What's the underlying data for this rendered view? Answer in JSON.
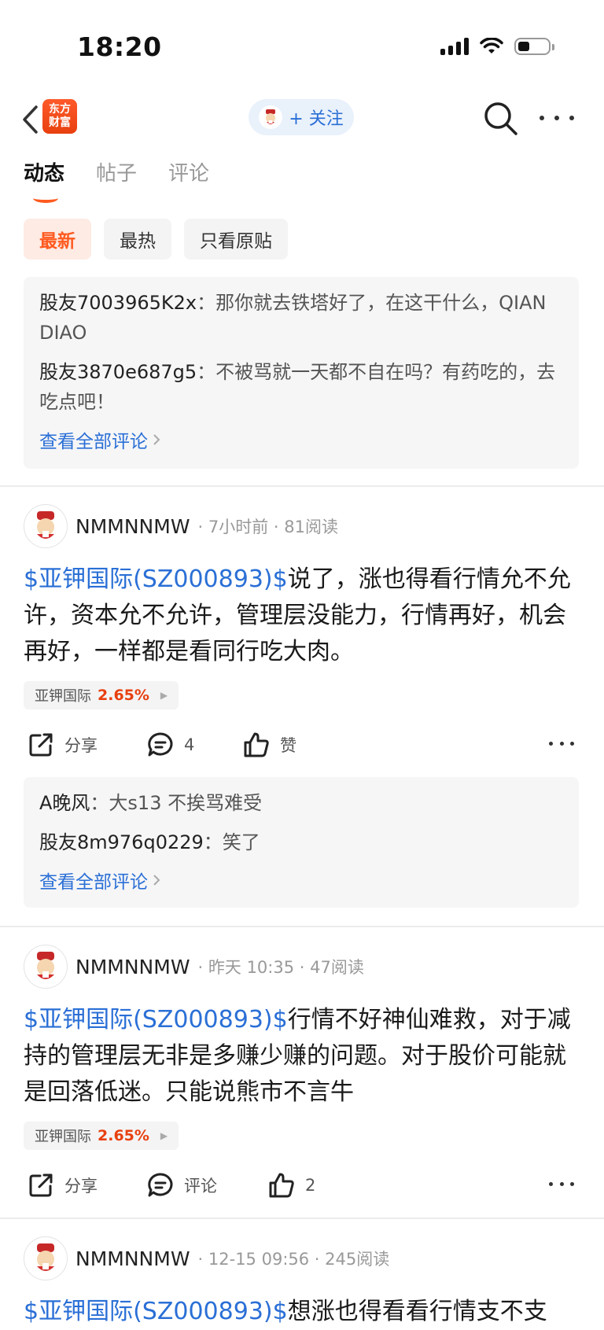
{
  "status": {
    "time": "18:20"
  },
  "nav": {
    "logo_line1": "东方",
    "logo_line2": "财富",
    "follow_label": "+ 关注"
  },
  "tabs": [
    {
      "label": "动态",
      "active": true
    },
    {
      "label": "帖子",
      "active": false
    },
    {
      "label": "评论",
      "active": false
    }
  ],
  "filters": [
    {
      "label": "最新",
      "active": true
    },
    {
      "label": "最热",
      "active": false
    },
    {
      "label": "只看原贴",
      "active": false
    }
  ],
  "top_comments": {
    "items": [
      {
        "user": "股友7003965K2x",
        "sep": "：",
        "text": "那你就去铁塔好了，在这干什么，QIAN DIAO"
      },
      {
        "user": "股友3870e687g5",
        "sep": "：",
        "text": "不被骂就一天都不自在吗？有药吃的，去吃点吧！"
      }
    ],
    "view_all": "查看全部评论"
  },
  "posts": [
    {
      "user": "NMMNNMW",
      "meta": "· 7小时前 · 81阅读",
      "stock_link": "$亚钾国际(SZ000893)$",
      "text": "说了，涨也得看行情允不允许，资本允不允许，管理层没能力，行情再好，机会再好，一样都是看同行吃大肉。",
      "tag_name": "亚钾国际",
      "tag_pct": "2.65%",
      "share": "分享",
      "comment": "4",
      "like": "赞",
      "comments": [
        {
          "user": "A晚风",
          "sep": "：",
          "text": "大s13 不挨骂难受"
        },
        {
          "user": "股友8m976q0229",
          "sep": "：",
          "text": "笑了"
        }
      ],
      "view_all": "查看全部评论"
    },
    {
      "user": "NMMNNMW",
      "meta": "· 昨天 10:35 · 47阅读",
      "stock_link": "$亚钾国际(SZ000893)$",
      "text": "行情不好神仙难救，对于减持的管理层无非是多赚少赚的问题。对于股价可能就是回落低迷。只能说熊市不言牛",
      "tag_name": "亚钾国际",
      "tag_pct": "2.65%",
      "share": "分享",
      "comment": "评论",
      "like": "2"
    },
    {
      "user": "NMMNNMW",
      "meta": "· 12-15 09:56 · 245阅读",
      "stock_link": "$亚钾国际(SZ000893)$",
      "text": "想涨也得看看行情支不支"
    }
  ]
}
